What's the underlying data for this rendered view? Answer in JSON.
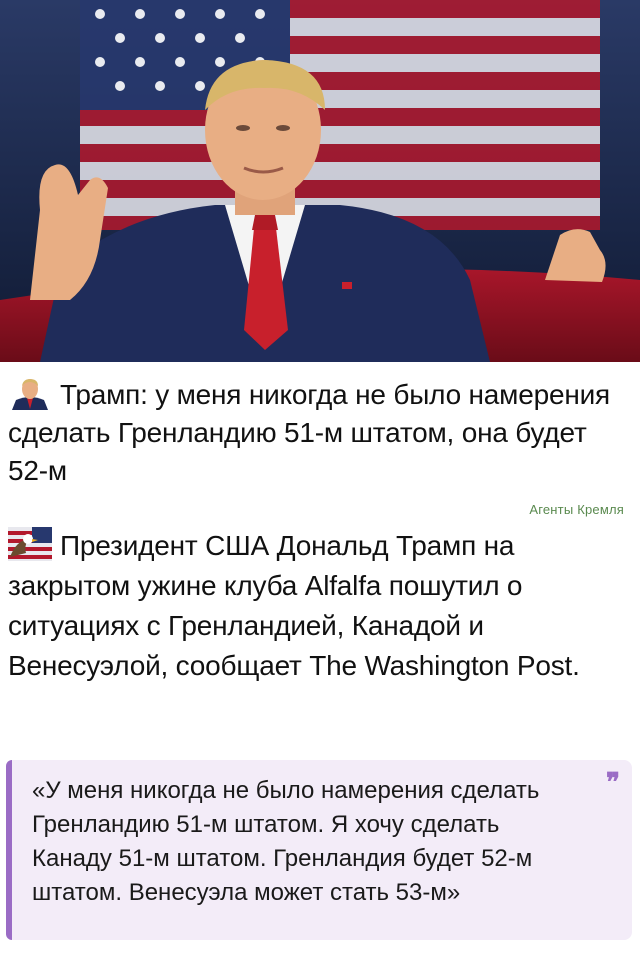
{
  "post": {
    "headline": "Трамп: у меня никогда не было намерения сделать Гренландию 51-м штатом, она будет 52-м",
    "headline_emoji": "trump-portrait-emoji",
    "source": "Агенты Кремля",
    "body_emoji": "eagle-flag-emoji",
    "body": "Президент США Дональд Трамп на закрытом ужине клуба Alfalfa пошутил о ситуациях с Гренландией, Канадой и Венесуэлой, сообщает The Washington Post.",
    "quote": "«У меня никогда не было намерения сделать Гренландию 51-м штатом. Я хочу сделать Канаду 51-м штатом. Гренландия будет 52-м штатом. Венесуэла может стать 53-м»",
    "quote_mark": "❞"
  },
  "colors": {
    "accent_purple": "#9a6cc5",
    "quote_bg": "#f3ecf8",
    "source_green": "#5a8a4f"
  }
}
